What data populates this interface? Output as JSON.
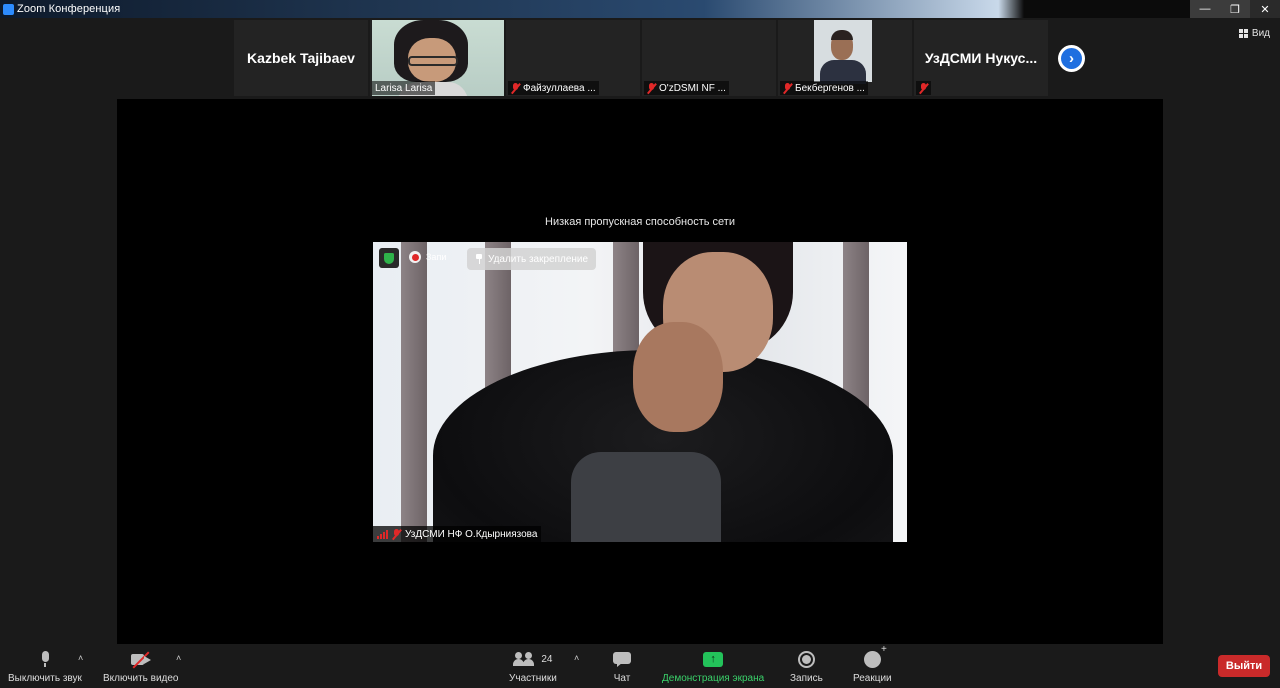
{
  "window": {
    "title": "Zoom Конференция"
  },
  "strip": {
    "tiles": [
      {
        "name": "Kazbek Tajibaev"
      },
      {
        "name": "Larisa Larisa"
      },
      {
        "name": "Файзуллаева ..."
      },
      {
        "name": "O'zDSMI NF ..."
      },
      {
        "name": "Бекбергенов ..."
      },
      {
        "name": "УзДСМИ  Нукус..."
      }
    ],
    "view_label": "Вид"
  },
  "stage": {
    "bandwidth_notice": "Низкая пропускная способность сети",
    "pinned_video": {
      "rec_label": "Запи",
      "unpin_label": "Удалить закрепление",
      "participant_name": "УзДСМИ НФ О.Кдырниязова"
    }
  },
  "toolbar": {
    "mute_label": "Выключить звук",
    "video_label": "Включить видео",
    "participants_label": "Участники",
    "participants_count": "24",
    "chat_label": "Чат",
    "share_label": "Демонстрация экрана",
    "record_label": "Запись",
    "reactions_label": "Реакции",
    "leave_label": "Выйти"
  },
  "colors": {
    "accent_blue": "#2d8cff",
    "share_green": "#23c25a",
    "leave_red": "#c92a2a",
    "muted_red": "#e02828"
  }
}
